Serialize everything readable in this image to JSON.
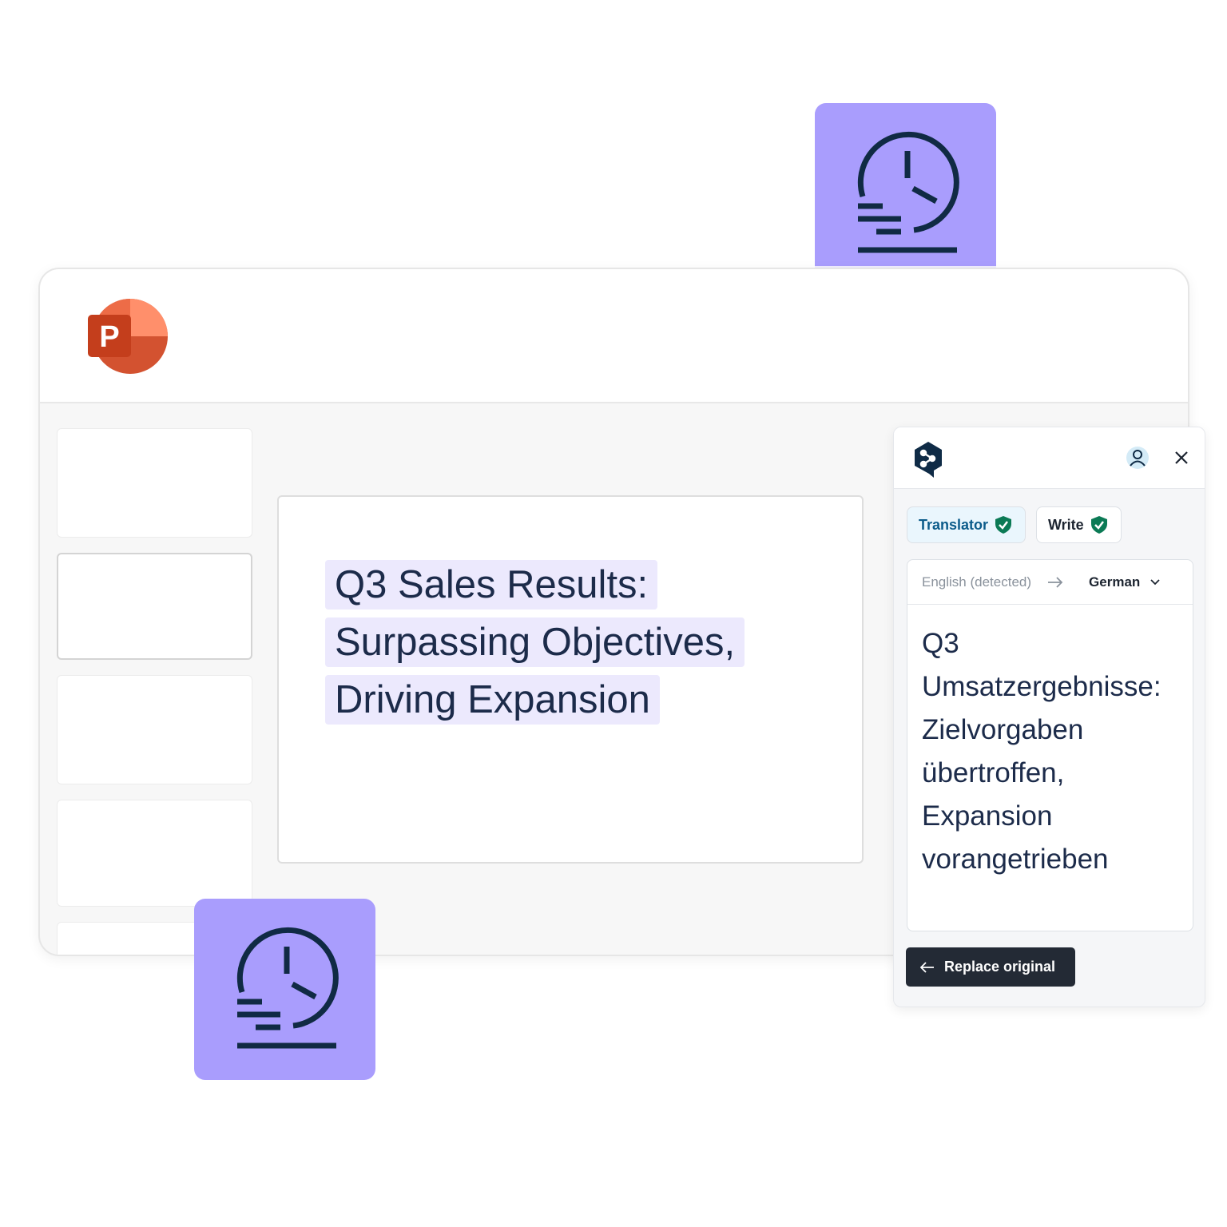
{
  "app": {
    "name": "PowerPoint",
    "logo_letter": "P"
  },
  "slide": {
    "title_lines": [
      "Q3 Sales Results:",
      "Surpassing Objectives,",
      "Driving Expansion"
    ]
  },
  "panel": {
    "tabs": [
      {
        "label": "Translator",
        "active": true,
        "icon": "shield-check-icon"
      },
      {
        "label": "Write",
        "active": false,
        "icon": "shield-check-icon"
      }
    ],
    "source_language": "English (detected)",
    "target_language": "German",
    "translation_lines": [
      "Q3",
      "Umsatzergebnisse:",
      "Zielvorgaben",
      "übertroffen,",
      "Expansion",
      "vorangetrieben"
    ],
    "replace_button": "Replace original"
  },
  "colors": {
    "tile": "#a99dfd",
    "highlight": "#ece9fd",
    "navy": "#0f2b46",
    "shield": "#0b7a55",
    "button": "#232a35"
  }
}
